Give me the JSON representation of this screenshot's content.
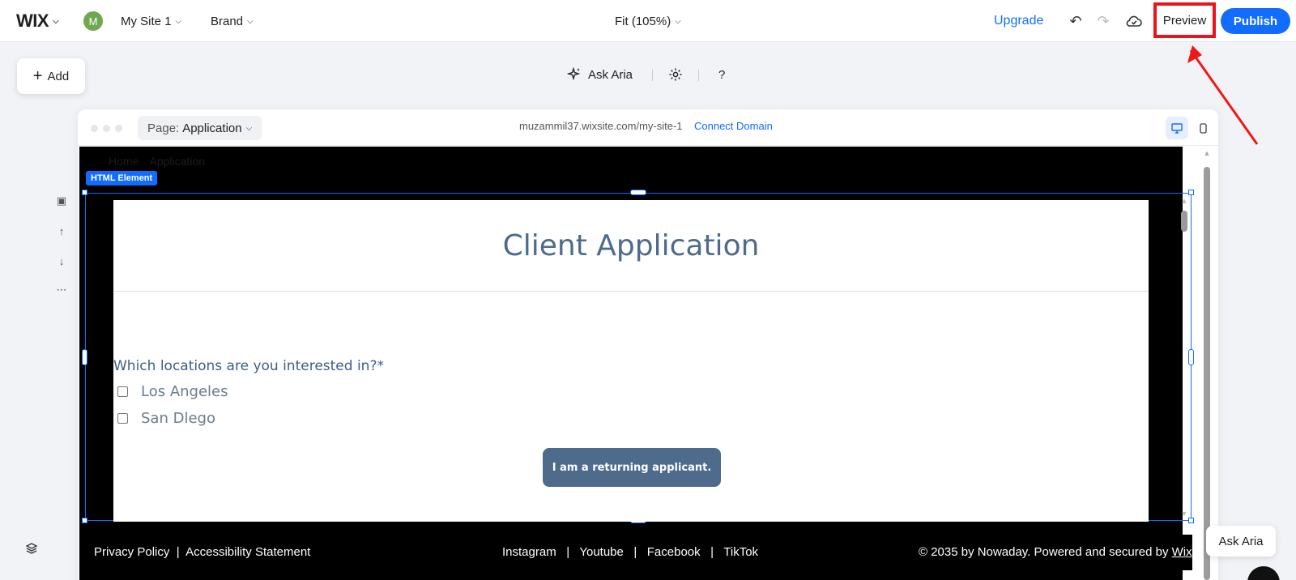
{
  "topbar": {
    "logo": "WIX",
    "avatar_letter": "M",
    "site_name": "My Site 1",
    "brand": "Brand",
    "zoom": "Fit (105%)",
    "upgrade": "Upgrade",
    "preview": "Preview",
    "publish": "Publish"
  },
  "toolbar": {
    "add": "Add",
    "ask_aria": "Ask Aria",
    "help": "?"
  },
  "browser": {
    "page_label": "Page:",
    "page_name": "Application",
    "url": "muzammil37.wixsite.com/my-site-1",
    "connect_domain": "Connect Domain"
  },
  "site": {
    "nav_items": [
      "Home",
      "Application"
    ],
    "html_tag": "HTML Element",
    "form": {
      "title": "Client Application",
      "question": "Which locations are you interested in?*",
      "options": [
        "Los Angeles",
        "San Dlego"
      ],
      "returning_button": "I am a returning applicant."
    },
    "footer": {
      "privacy": "Privacy Policy",
      "accessibility": "Accessibility Statement",
      "social": [
        "Instagram",
        "Youtube",
        "Facebook",
        "TikTok"
      ],
      "copyright": "© 2035 by Nowaday. Powered and secured by",
      "wix_link": "Wix"
    }
  },
  "assistant": {
    "bubble": "Ask Aria"
  },
  "colors": {
    "accent": "#116dff",
    "highlight": "#e8141b",
    "form_text": "#4e6b8c",
    "avatar": "#6fa851"
  }
}
